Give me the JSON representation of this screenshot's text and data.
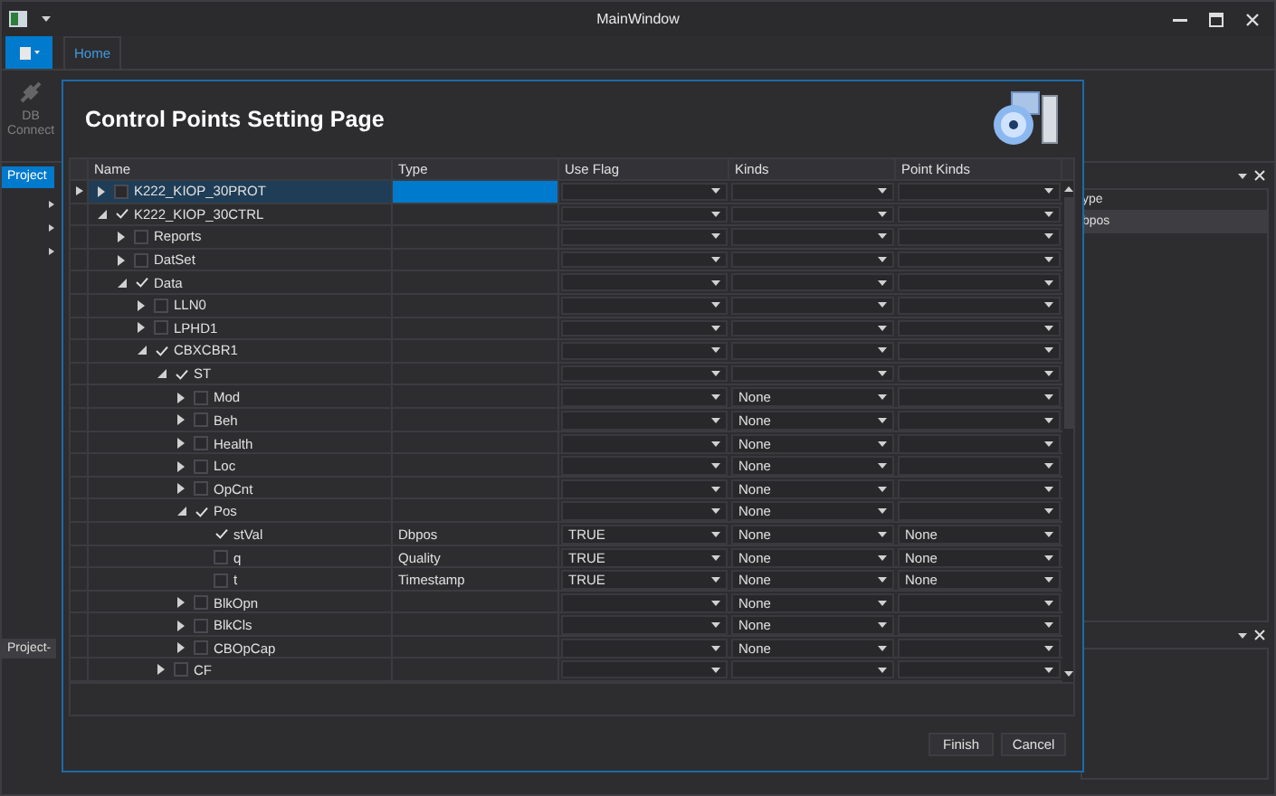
{
  "window": {
    "title": "MainWindow"
  },
  "ribbon": {
    "tabs": [
      {
        "label": "Home",
        "selected": true
      }
    ],
    "buttons": [
      {
        "label": "DB Connect",
        "disabled": true
      }
    ]
  },
  "left_panel": {
    "tab": "Project"
  },
  "bottom_panel": {
    "tab": "Project-"
  },
  "right_panel": {
    "header": "ype",
    "rows": [
      {
        "text": "bpos",
        "selected": true
      }
    ]
  },
  "dialog": {
    "title": "Control Points Setting Page",
    "columns": [
      "Name",
      "Type",
      "Use Flag",
      "Kinds",
      "Point Kinds"
    ],
    "rows": [
      {
        "name": "K222_KIOP_30PROT",
        "checked": false,
        "expanded": false,
        "selected": true
      },
      {
        "name": "K222_KIOP_30CTRL",
        "checked": true,
        "expanded": true,
        "selected": false,
        "children": [
          {
            "name": "Reports",
            "checked": false,
            "expanded": false,
            "selected": false
          },
          {
            "name": "DatSet",
            "checked": false,
            "expanded": false,
            "selected": false
          },
          {
            "name": "Data",
            "checked": true,
            "expanded": true,
            "selected": false,
            "children": [
              {
                "name": "LLN0",
                "checked": false,
                "expanded": false,
                "selected": false
              },
              {
                "name": "LPHD1",
                "checked": false,
                "expanded": false,
                "selected": false
              },
              {
                "name": "CBXCBR1",
                "checked": true,
                "expanded": true,
                "selected": false,
                "children": [
                  {
                    "name": "ST",
                    "checked": true,
                    "expanded": true,
                    "selected": false,
                    "children": [
                      {
                        "name": "Mod",
                        "checked": false,
                        "expanded": false,
                        "selected": false,
                        "kinds": "None"
                      },
                      {
                        "name": "Beh",
                        "checked": false,
                        "expanded": false,
                        "selected": false,
                        "kinds": "None"
                      },
                      {
                        "name": "Health",
                        "checked": false,
                        "expanded": false,
                        "selected": false,
                        "kinds": "None"
                      },
                      {
                        "name": "Loc",
                        "checked": false,
                        "expanded": false,
                        "selected": false,
                        "kinds": "None"
                      },
                      {
                        "name": "OpCnt",
                        "checked": false,
                        "expanded": false,
                        "selected": false,
                        "kinds": "None"
                      },
                      {
                        "name": "Pos",
                        "checked": true,
                        "expanded": true,
                        "selected": false,
                        "kinds": "None",
                        "children": [
                          {
                            "name": "stVal",
                            "checked": true,
                            "selected": false,
                            "type": "Dbpos",
                            "use_flag": "TRUE",
                            "kinds": "None",
                            "point_kinds": "None"
                          },
                          {
                            "name": "q",
                            "checked": false,
                            "selected": false,
                            "type": "Quality",
                            "use_flag": "TRUE",
                            "kinds": "None",
                            "point_kinds": "None"
                          },
                          {
                            "name": "t",
                            "checked": false,
                            "selected": false,
                            "type": "Timestamp",
                            "use_flag": "TRUE",
                            "kinds": "None",
                            "point_kinds": "None"
                          }
                        ]
                      },
                      {
                        "name": "BlkOpn",
                        "checked": false,
                        "expanded": false,
                        "selected": false,
                        "kinds": "None"
                      },
                      {
                        "name": "BlkCls",
                        "checked": false,
                        "expanded": false,
                        "selected": false,
                        "kinds": "None"
                      },
                      {
                        "name": "CBOpCap",
                        "checked": false,
                        "expanded": false,
                        "selected": false,
                        "kinds": "None"
                      }
                    ]
                  },
                  {
                    "name": "CF",
                    "checked": false,
                    "expanded": false,
                    "selected": false
                  }
                ]
              }
            ]
          }
        ]
      }
    ],
    "buttons": [
      "Finish",
      "Cancel"
    ]
  }
}
